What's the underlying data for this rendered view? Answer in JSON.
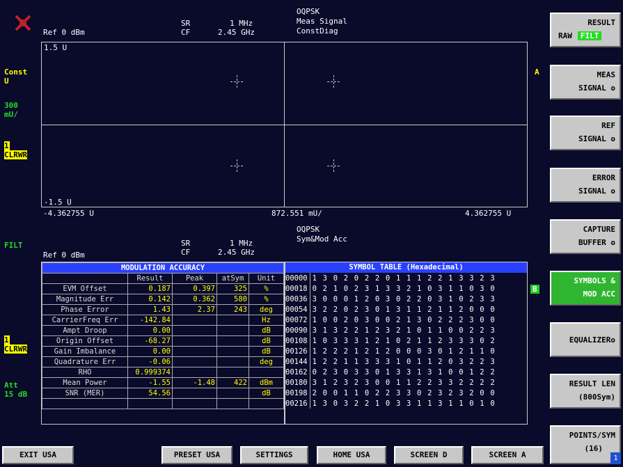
{
  "colors": {
    "background": "#0a0a2a",
    "trace_text": "#ffff00",
    "active_key": "#2fb52f",
    "table_header": "#2a40ff"
  },
  "top_screen": {
    "ref": "Ref 0 dBm",
    "sr_label": "SR",
    "sr_value": "1 MHz",
    "cf_label": "CF",
    "cf_value": "2.45 GHz",
    "modulation": "OQPSK",
    "meas": "Meas Signal",
    "view": "ConstDiag",
    "y_top": "1.5 U",
    "y_bottom": "-1.5 U",
    "x_left": "-4.362755 U",
    "x_mid": "872.551 mU/",
    "x_right": "4.362755 U",
    "trace_label": "A",
    "left": {
      "const": "Const",
      "unit": "U",
      "scale_val": "300",
      "scale_unit": "mU/",
      "trace_num": "1",
      "trace_mode": "CLRWR"
    }
  },
  "bottom_screen": {
    "ref": "Ref 0 dBm",
    "sr_label": "SR",
    "sr_value": "1 MHz",
    "cf_label": "CF",
    "cf_value": "2.45 GHz",
    "modulation": "OQPSK",
    "meas": "Sym&Mod Acc",
    "trace_label": "B",
    "left": {
      "filt": "FILT",
      "trace_num": "1",
      "trace_mode": "CLRWR",
      "att": "Att",
      "att_val": "15 dB"
    }
  },
  "mod_acc": {
    "title": "MODULATION ACCURACY",
    "headers": [
      "",
      "Result",
      "Peak",
      "atSym",
      "Unit"
    ],
    "rows": [
      [
        "EVM Offset",
        "0.187",
        "0.397",
        "325",
        "%"
      ],
      [
        "Magnitude Err",
        "0.142",
        "0.362",
        "580",
        "%"
      ],
      [
        "Phase Error",
        "1.43",
        "2.37",
        "243",
        "deg"
      ],
      [
        "CarrierFreq Err",
        "-142.84",
        "",
        "",
        "Hz"
      ],
      [
        "Ampt Droop",
        "0.00",
        "",
        "",
        "dB"
      ],
      [
        "Origin Offset",
        "-68.27",
        "",
        "",
        "dB"
      ],
      [
        "Gain Imbalance",
        "0.00",
        "",
        "",
        "dB"
      ],
      [
        "Quadrature Err",
        "-0.06",
        "",
        "",
        "deg"
      ],
      [
        "RHO",
        "0.999374",
        "",
        "",
        ""
      ],
      [
        "Mean Power",
        "-1.55",
        "-1.48",
        "422",
        "dBm"
      ],
      [
        "SNR (MER)",
        "54.56",
        "",
        "",
        "dB"
      ],
      [
        "",
        "",
        "",
        "",
        ""
      ]
    ]
  },
  "symbol_table": {
    "title": "SYMBOL TABLE (Hexadecimal)",
    "rows": [
      [
        "00000",
        "1 3 0 2 0 2 2 0 1 1 1 2 2 1 3 3 2 3"
      ],
      [
        "00018",
        "0 2 1 0 2 3 1 3 3 2 1 0 3 1 1 0 3 0"
      ],
      [
        "00036",
        "3 0 0 0 1 2 0 3 0 2 2 0 3 1 0 2 3 3"
      ],
      [
        "00054",
        "3 2 2 0 2 3 0 1 3 1 1 2 1 1 2 0 0 0"
      ],
      [
        "00072",
        "1 0 0 2 0 3 0 0 2 1 3 0 2 2 2 3 0 0"
      ],
      [
        "00090",
        "3 1 3 2 2 1 2 3 2 1 0 1 1 0 0 2 2 3"
      ],
      [
        "00108",
        "1 0 3 3 3 1 2 1 0 2 1 1 2 3 3 3 0 2"
      ],
      [
        "00126",
        "1 2 2 2 1 2 1 2 0 0 0 3 0 1 2 1 1 0"
      ],
      [
        "00144",
        "1 2 2 1 1 3 3 3 1 0 1 1 2 0 3 2 2 3"
      ],
      [
        "00162",
        "0 2 3 0 3 3 0 1 3 3 1 3 1 0 0 1 2 2"
      ],
      [
        "00180",
        "3 1 2 3 2 3 0 0 1 1 2 2 3 3 2 2 2 2"
      ],
      [
        "00198",
        "2 0 0 1 1 0 2 2 3 3 0 2 3 2 3 2 0 0"
      ],
      [
        "00216",
        "1 3 0 3 2 2 1 0 3 3 1 1 3 1 1 0 1 0"
      ]
    ]
  },
  "softkeys": {
    "result": {
      "title": "RESULT",
      "raw": "RAW",
      "filt": "FILT"
    },
    "meas_signal": [
      "MEAS",
      "SIGNAL o"
    ],
    "ref_signal": [
      "REF",
      "SIGNAL o"
    ],
    "error_signal": [
      "ERROR",
      "SIGNAL o"
    ],
    "capture_buffer": [
      "CAPTURE",
      "BUFFER o"
    ],
    "symbols": [
      "SYMBOLS &",
      "MOD ACC"
    ],
    "equalizer": "EQUALIZERo",
    "result_len": [
      "RESULT LEN",
      "(800Sym)"
    ],
    "points_sym": [
      "POINTS/SYM",
      "(16)"
    ],
    "corner": "1"
  },
  "hotkeys": {
    "exit": "EXIT USA",
    "preset": "PRESET USA",
    "settings": "SETTINGS",
    "home": "HOME USA",
    "screen_d": "SCREEN D",
    "screen_a": "SCREEN A"
  }
}
